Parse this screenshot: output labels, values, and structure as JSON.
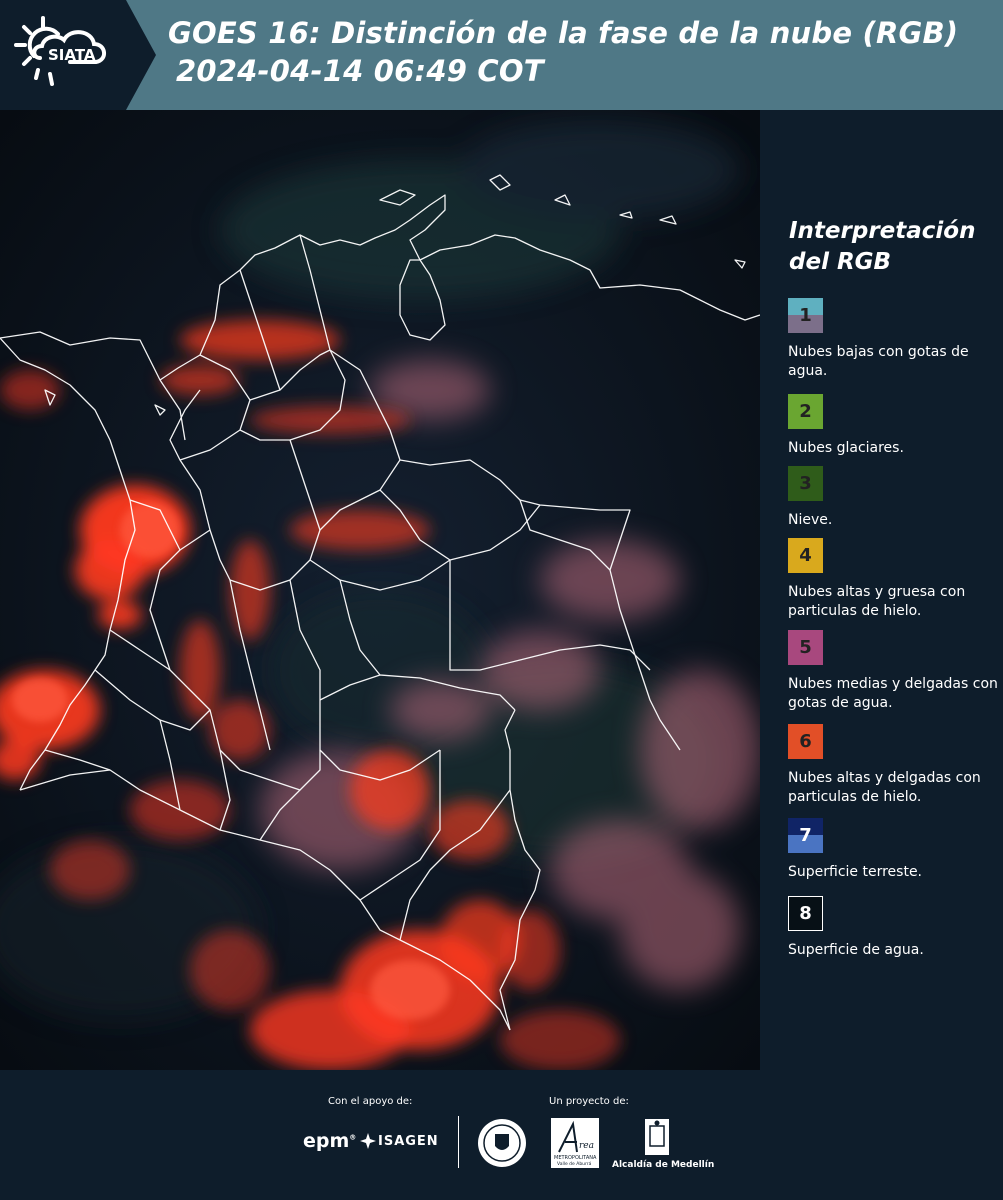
{
  "header": {
    "title_line1": "GOES 16: Distinción de la fase de la nube (RGB)",
    "title_line2": "2024-04-14 06:49 COT",
    "logo_text": "SIATA"
  },
  "legend": {
    "title_line1": "Interpretación",
    "title_line2": "del RGB",
    "items": [
      {
        "num": "1",
        "label": "Nubes bajas con gotas de agua.",
        "color_top": "#5fb0c0",
        "color_bottom": "#7c6f8a"
      },
      {
        "num": "2",
        "label": "Nubes glaciares.",
        "color_top": "#6aa631",
        "color_bottom": "#6aa631"
      },
      {
        "num": "3",
        "label": "Nieve.",
        "color_top": "#2f5c1a",
        "color_bottom": "#2f5c1a"
      },
      {
        "num": "4",
        "label": "Nubes altas y gruesa con particulas de hielo.",
        "color_top": "#d9a91d",
        "color_bottom": "#d9a91d"
      },
      {
        "num": "5",
        "label": "Nubes medias y delgadas con gotas de agua.",
        "color_top": "#a8487e",
        "color_bottom": "#a8487e"
      },
      {
        "num": "6",
        "label": "Nubes altas y delgadas con particulas de hielo.",
        "color_top": "#e24f27",
        "color_bottom": "#e24f27"
      },
      {
        "num": "7",
        "label": "Superficie terreste.",
        "color_top": "#102466",
        "color_bottom": "#4a74c2"
      },
      {
        "num": "8",
        "label": "Superficie de agua.",
        "color_top": "#071016",
        "color_bottom": "#071016"
      }
    ]
  },
  "footer": {
    "support_label": "Con el apoyo de:",
    "project_label": "Un proyecto de:",
    "epm": "epm",
    "isagen": "ISAGEN",
    "area_metro_line1": "METROPOLITANA",
    "area_metro_line2": "Valle de Aburrá",
    "alcaldia": "Alcaldía de Medellín"
  },
  "colors": {
    "header_bg": "#4f7886",
    "panel_bg": "#0e1d2b",
    "cloud_red": "#ff3a20",
    "cloud_pink": "#c46e7c",
    "border_white": "#ffffff"
  }
}
